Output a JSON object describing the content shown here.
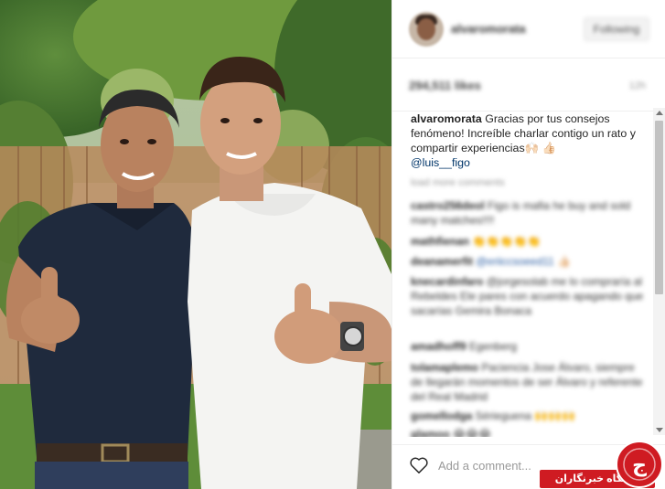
{
  "post": {
    "author": "alvaromorata",
    "follow_label": "Following",
    "likes": "294,511 likes",
    "time_ago": "12h",
    "caption_user": "alvaromorata",
    "caption_text": " Gracias por tus consejos fenómeno! Increíble charlar contigo un rato y compartir experiencias🙌🏻 👍🏻",
    "caption_mention": "@luis__figo"
  },
  "load_more": "load more comments",
  "comments": [
    {
      "user": "castro256deol",
      "text": " Figo is mafia he buy and sold many matches!!!!"
    },
    {
      "user": "mathfienan",
      "text": " 👏👏👏👏👏"
    },
    {
      "user": "deanamerfit",
      "text": " @eriiccsoeed11 👍🏻",
      "blue": true
    },
    {
      "user": "knecardinfaro",
      "text": " @jorgesolab me lo compraría al Rebeldes Ele pares con acuerdo apagando que sacarías Gemira Bonaca"
    },
    {
      "user": "amadhoff9",
      "text": " Egenberg"
    },
    {
      "user": "tolamaplemo",
      "text": " Paciencia Jose Álvaro, siempre de llegarán momentos de ser Álvaro y referente del Real Madrid"
    },
    {
      "user": "gomellodga",
      "text": " Sérieguena 🙌🙌🙌"
    },
    {
      "user": "glamoo",
      "text": " 😂😂😂"
    }
  ],
  "add_comment_placeholder": "Add a comment...",
  "watermark": {
    "text": "باشگاه خبرنگاران",
    "logo_letter": "ج",
    "color": "#cf1b22"
  },
  "colors": {
    "mention_blue": "#003569",
    "text": "#262626",
    "muted": "#999999"
  }
}
